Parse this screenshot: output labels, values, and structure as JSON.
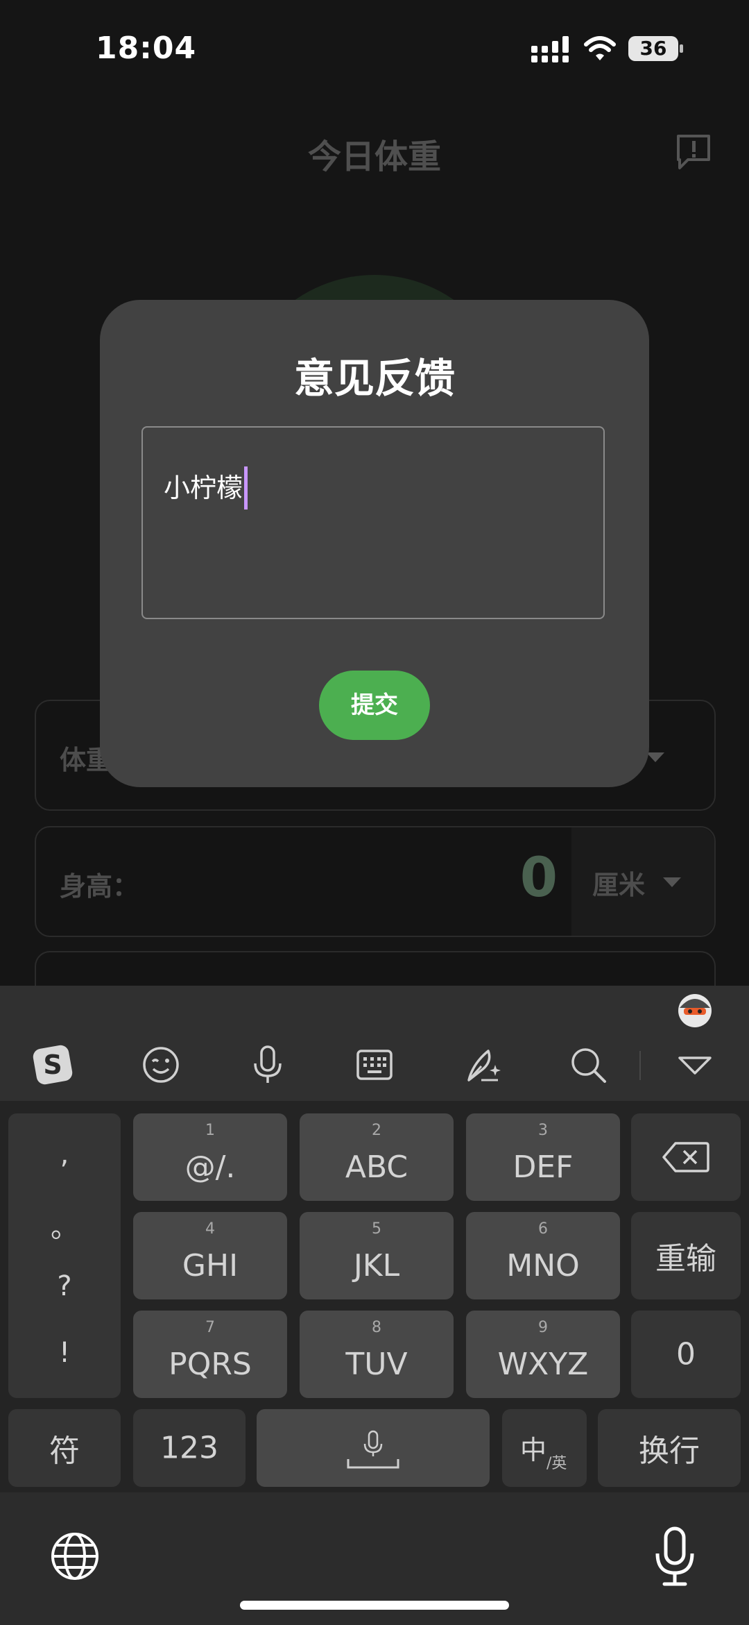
{
  "status_bar": {
    "time": "18:04",
    "battery": "36"
  },
  "page": {
    "title": "今日体重",
    "fields": [
      {
        "label": "体重"
      },
      {
        "label": "身高：",
        "value": "0",
        "unit": "厘米"
      }
    ]
  },
  "dialog": {
    "title": "意见反馈",
    "input_value": "小柠檬",
    "submit_label": "提交"
  },
  "keyboard": {
    "toolbar": [
      "sogou-logo-icon",
      "emoji-icon",
      "mic-icon",
      "keyboard-icon",
      "handwriting-icon",
      "search-icon",
      "collapse-icon"
    ],
    "punctuation": [
      ",",
      "。",
      "?",
      "!"
    ],
    "keys": [
      {
        "num": "1",
        "label": "@/."
      },
      {
        "num": "2",
        "label": "ABC"
      },
      {
        "num": "3",
        "label": "DEF"
      },
      {
        "num": "4",
        "label": "GHI"
      },
      {
        "num": "5",
        "label": "JKL"
      },
      {
        "num": "6",
        "label": "MNO"
      },
      {
        "num": "7",
        "label": "PQRS"
      },
      {
        "num": "8",
        "label": "TUV"
      },
      {
        "num": "9",
        "label": "WXYZ"
      }
    ],
    "reinput": "重输",
    "zero": "0",
    "symbols": "符",
    "numbers": "123",
    "lang_main": "中",
    "lang_sub": "/英",
    "enter": "换行"
  }
}
